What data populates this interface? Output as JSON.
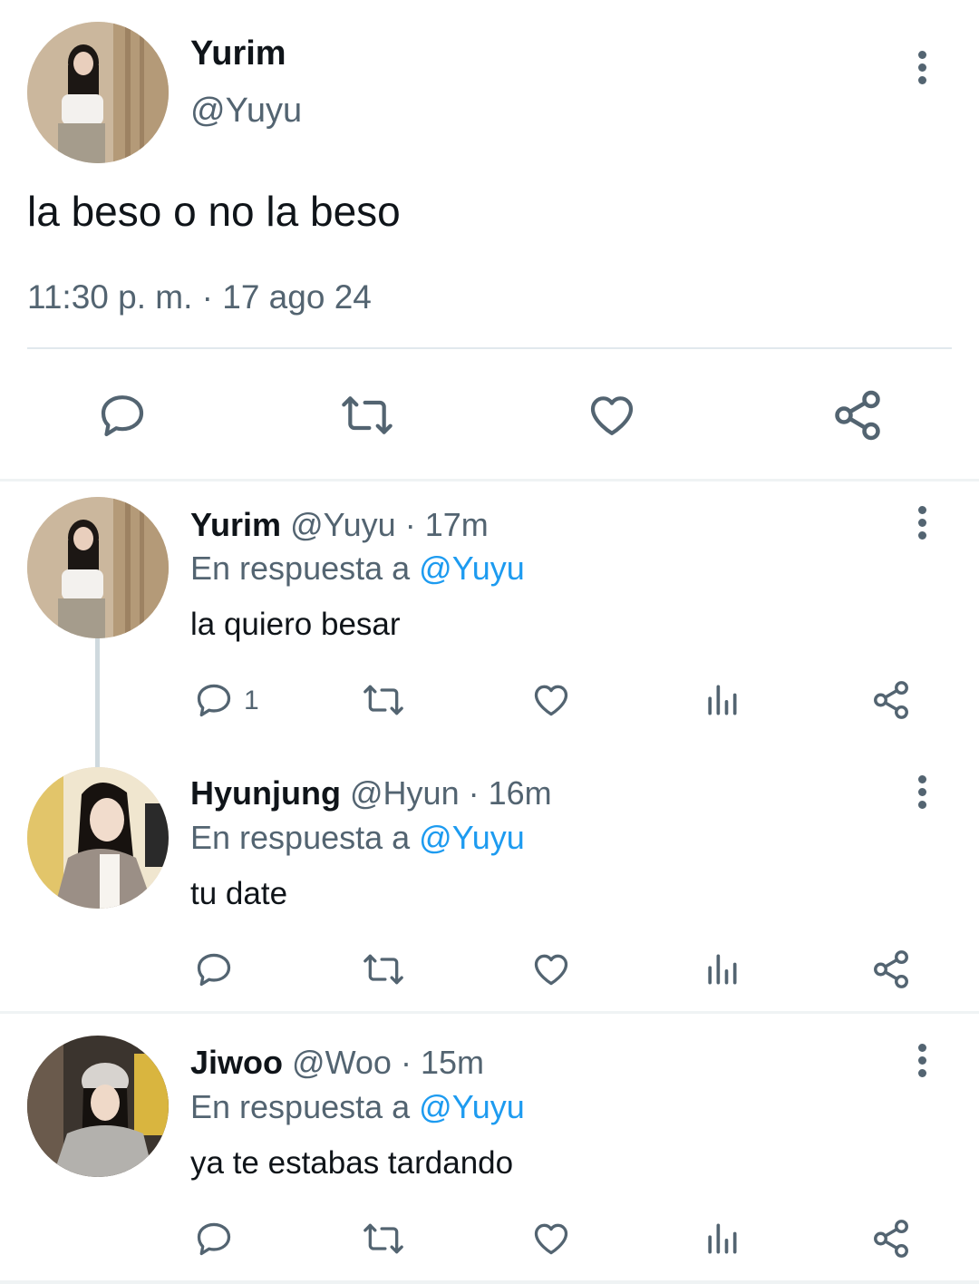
{
  "main_tweet": {
    "display_name": "Yurim",
    "handle": "@Yuyu",
    "text": "la beso o no la beso",
    "timestamp": "11:30 p. m. · 17 ago 24"
  },
  "replies": [
    {
      "display_name": "Yurim",
      "handle": "@Yuyu",
      "time": "· 17m",
      "reply_prefix": "En respuesta a",
      "reply_to": "@Yuyu",
      "text": "la quiero besar",
      "reply_count": "1"
    },
    {
      "display_name": "Hyunjung",
      "handle": "@Hyun",
      "time": "· 16m",
      "reply_prefix": "En respuesta a",
      "reply_to": "@Yuyu",
      "text": "tu date"
    },
    {
      "display_name": "Jiwoo",
      "handle": "@Woo",
      "time": "· 15m",
      "reply_prefix": "En respuesta a",
      "reply_to": "@Yuyu",
      "text": "ya te estabas tardando"
    }
  ],
  "colors": {
    "text": "#0f1419",
    "muted": "#536471",
    "link": "#1d9bf0",
    "divider": "#eff3f4"
  },
  "icons": [
    "reply-icon",
    "retweet-icon",
    "like-icon",
    "views-icon",
    "share-icon",
    "more-icon"
  ]
}
